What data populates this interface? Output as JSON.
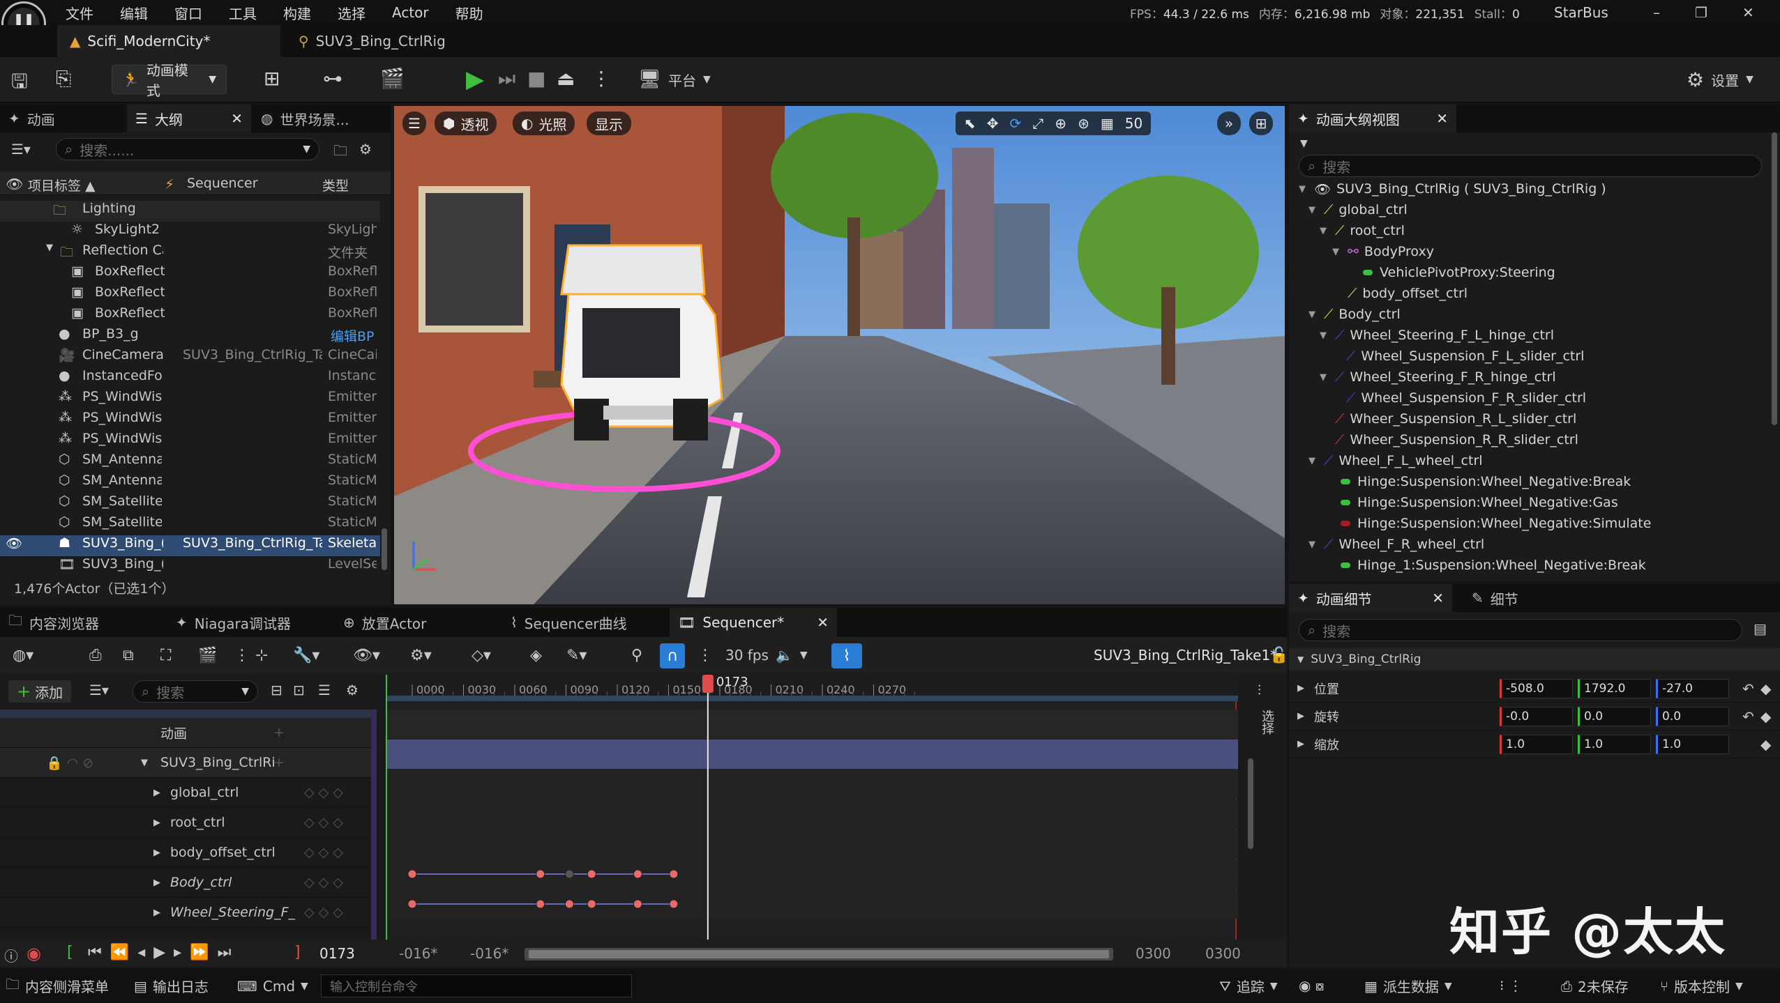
{
  "menu": [
    "文件",
    "编辑",
    "窗口",
    "工具",
    "构建",
    "选择",
    "Actor",
    "帮助"
  ],
  "logo_text": "U",
  "stats": {
    "fps_label": "FPS：",
    "fps": "44.3",
    "ms": "/ 22.6 ms",
    "mem_label": "内存：",
    "mem": "6,216.98 mb",
    "obj_label": "对象：",
    "obj": "221,351",
    "stall_label": "Stall：",
    "stall": "0"
  },
  "project": "StarBus",
  "window_controls": [
    "–",
    "❐",
    "✕"
  ],
  "doc_tabs": [
    {
      "label": "Scifi_ModernCity*"
    },
    {
      "label": "SUV3_Bing_CtrlRig"
    }
  ],
  "toolbar": {
    "mode_label": "动画模式",
    "platform_label": "平台",
    "settings_label": "设置"
  },
  "left_panel": {
    "tabs": [
      "动画",
      "大纲",
      "世界场景..."
    ],
    "search_placeholder": "搜索......",
    "columns": [
      "项目标签 ▲",
      "Sequencer",
      "类型"
    ],
    "rows": [
      {
        "name": "Lighting",
        "seq": "",
        "type": ""
      },
      {
        "name": "SkyLight2",
        "seq": "",
        "type": "SkyLigh"
      },
      {
        "name": "Reflection Ca",
        "seq": "",
        "type": "文件夹"
      },
      {
        "name": "BoxReflect",
        "seq": "",
        "type": "BoxRefl"
      },
      {
        "name": "BoxReflect",
        "seq": "",
        "type": "BoxRefl"
      },
      {
        "name": "BoxReflect",
        "seq": "",
        "type": "BoxRefl"
      },
      {
        "name": "BP_B3_g",
        "seq": "",
        "type": "编辑BP"
      },
      {
        "name": "CineCamera/",
        "seq": "SUV3_Bing_CtrlRig_Ta",
        "type": "CineCai"
      },
      {
        "name": "InstancedFol",
        "seq": "",
        "type": "Instanc"
      },
      {
        "name": "PS_WindWis",
        "seq": "",
        "type": "Emitter"
      },
      {
        "name": "PS_WindWis",
        "seq": "",
        "type": "Emitter"
      },
      {
        "name": "PS_WindWis",
        "seq": "",
        "type": "Emitter"
      },
      {
        "name": "SM_Antenna",
        "seq": "",
        "type": "StaticM"
      },
      {
        "name": "SM_Antenna",
        "seq": "",
        "type": "StaticM"
      },
      {
        "name": "SM_Satellitel",
        "seq": "",
        "type": "StaticM"
      },
      {
        "name": "SM_Satellitel",
        "seq": "",
        "type": "StaticM"
      },
      {
        "name": "SUV3_Bing_(",
        "seq": "SUV3_Bing_CtrlRig_Ta",
        "type": "Skeleta"
      },
      {
        "name": "SUV3_Bing_(",
        "seq": "",
        "type": "LevelSe"
      }
    ],
    "footer": "1,476个Actor（已选1个）"
  },
  "viewport": {
    "perspective": "透视",
    "lighting": "光照",
    "show": "显示",
    "grid_value": "50"
  },
  "right_top": {
    "tab": "动画大纲视图",
    "search_placeholder": "搜索",
    "items": [
      {
        "label": "SUV3_Bing_CtrlRig ( SUV3_Bing_CtrlRig )"
      },
      {
        "label": "global_ctrl"
      },
      {
        "label": "root_ctrl"
      },
      {
        "label": "BodyProxy"
      },
      {
        "label": "VehiclePivotProxy:Steering"
      },
      {
        "label": "body_offset_ctrl"
      },
      {
        "label": "Body_ctrl"
      },
      {
        "label": "Wheel_Steering_F_L_hinge_ctrl"
      },
      {
        "label": "Wheel_Suspension_F_L_slider_ctrl"
      },
      {
        "label": "Wheel_Steering_F_R_hinge_ctrl"
      },
      {
        "label": "Wheel_Suspension_F_R_slider_ctrl"
      },
      {
        "label": "Wheer_Suspension_R_L_slider_ctrl"
      },
      {
        "label": "Wheer_Suspension_R_R_slider_ctrl"
      },
      {
        "label": "Wheel_F_L_wheel_ctrl"
      },
      {
        "label": "Hinge:Suspension:Wheel_Negative:Break"
      },
      {
        "label": "Hinge:Suspension:Wheel_Negative:Gas"
      },
      {
        "label": "Hinge:Suspension:Wheel_Negative:Simulate"
      },
      {
        "label": "Wheel_F_R_wheel_ctrl"
      },
      {
        "label": "Hinge_1:Suspension:Wheel_Negative:Break"
      }
    ]
  },
  "right_bottom": {
    "tabs": [
      "动画细节",
      "细节"
    ],
    "search_placeholder": "搜索",
    "section": "SUV3_Bing_CtrlRig",
    "props": [
      {
        "label": "位置",
        "x": "-508.0",
        "y": "1792.0",
        "z": "-27.0"
      },
      {
        "label": "旋转",
        "x": "-0.0",
        "y": "0.0",
        "z": "0.0"
      },
      {
        "label": "缩放",
        "x": "1.0",
        "y": "1.0",
        "z": "1.0"
      }
    ]
  },
  "bottom_tabs": [
    "内容浏览器",
    "Niagara调试器",
    "放置Actor",
    "Sequencer曲线",
    "Sequencer*"
  ],
  "sequencer": {
    "fps_label": "30 fps",
    "sequence_name": "SUV3_Bing_CtrlRig_Take1*",
    "add_label": "添加",
    "search_placeholder": "搜索",
    "tracks": [
      "动画",
      "SUV3_Bing_CtrlRi",
      "global_ctrl",
      "root_ctrl",
      "body_offset_ctrl",
      "Body_ctrl",
      "Wheel_Steering_F_"
    ],
    "ruler_ticks": [
      "0000",
      "0030",
      "0060",
      "0090",
      "0120",
      "0150",
      "0180",
      "0210",
      "0240",
      "0270"
    ],
    "playhead_frame": "0173",
    "current_frame": "0173",
    "range_start_a": "-016*",
    "range_start_b": "-016*",
    "range_end_a": "0300",
    "range_end_b": "0300",
    "side_label": "选择"
  },
  "statusbar": {
    "drawer": "内容侧滑菜单",
    "log": "输出日志",
    "cmd": "Cmd",
    "console_placeholder": "输入控制台命令",
    "trace": "追踪",
    "derived": "派生数据",
    "unsaved": "2未保存",
    "version": "版本控制"
  },
  "watermark": "知乎 @太太"
}
